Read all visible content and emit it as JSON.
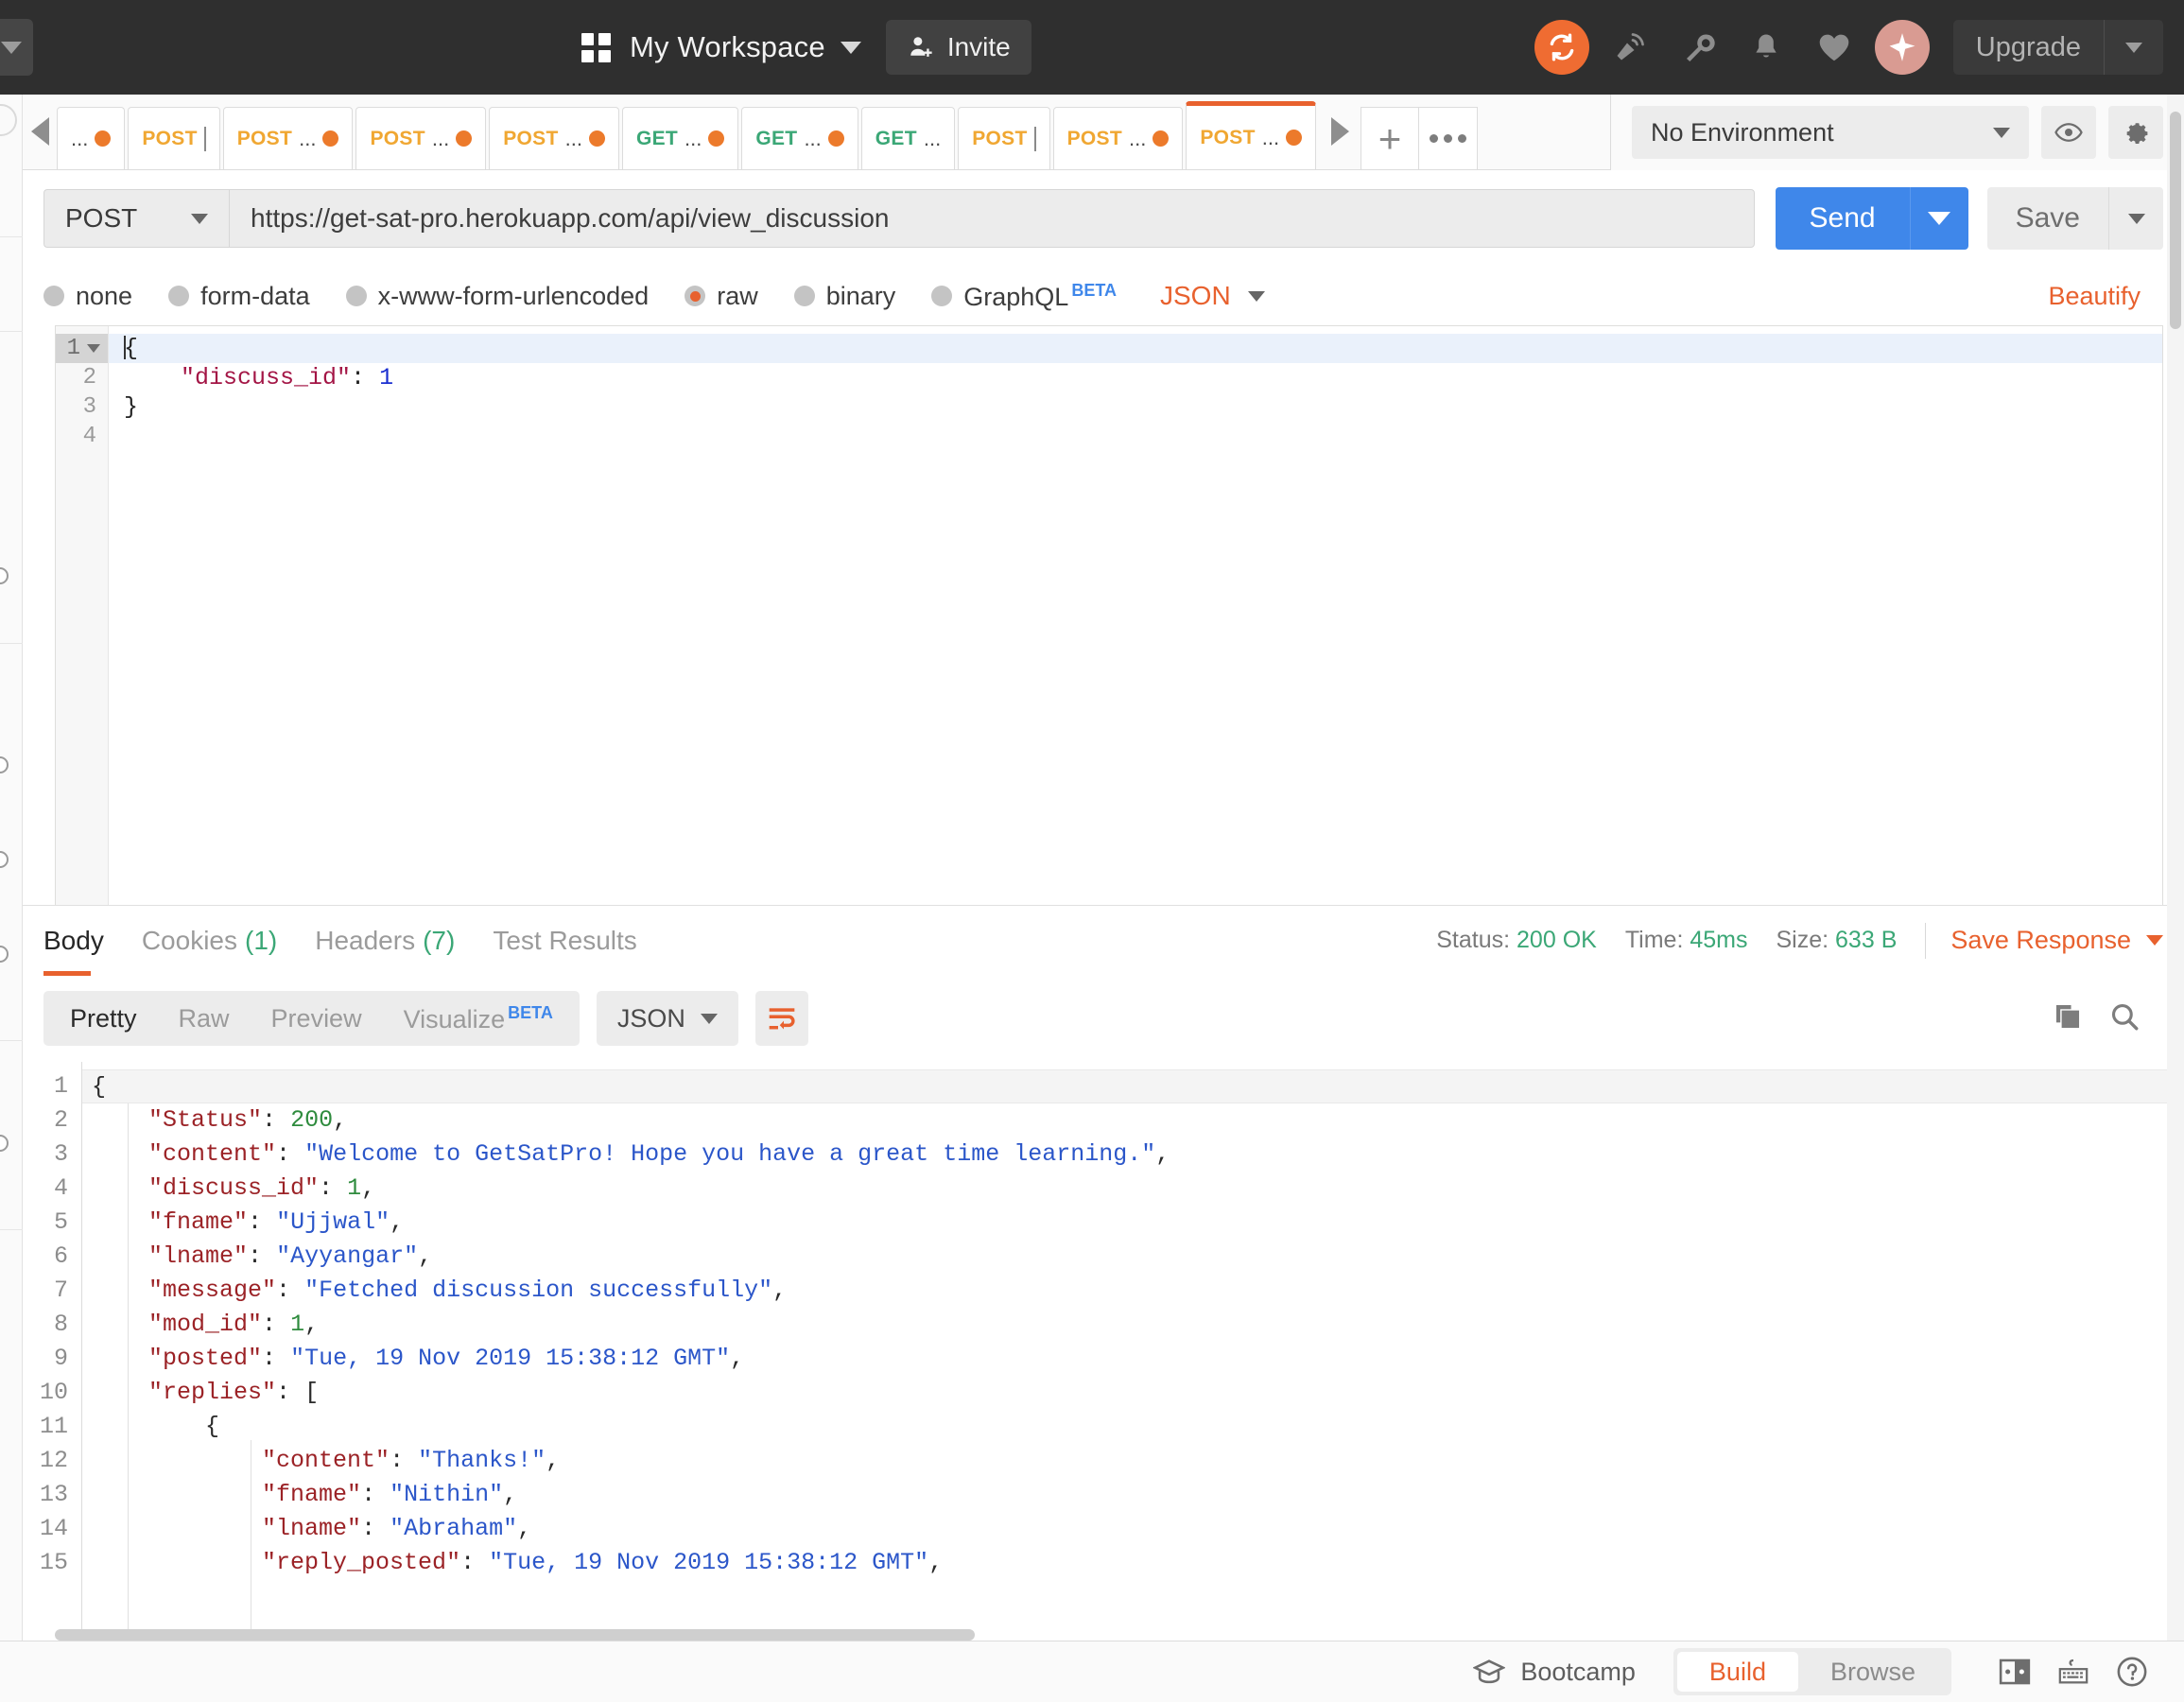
{
  "topbar": {
    "workspace_name": "My Workspace",
    "invite_label": "Invite",
    "upgrade_label": "Upgrade",
    "icons": [
      "sync-icon",
      "satellite-icon",
      "wrench-icon",
      "bell-icon",
      "heart-icon",
      "sparkle-icon"
    ]
  },
  "tabs": {
    "items": [
      {
        "method": "",
        "title": "...",
        "dirty": true,
        "active": false
      },
      {
        "method": "POST",
        "title": "",
        "dirty": false,
        "active": false,
        "cursor": true
      },
      {
        "method": "POST",
        "title": "...",
        "dirty": true,
        "active": false
      },
      {
        "method": "POST",
        "title": "...",
        "dirty": true,
        "active": false
      },
      {
        "method": "POST",
        "title": "...",
        "dirty": true,
        "active": false
      },
      {
        "method": "GET",
        "title": "...",
        "dirty": true,
        "active": false
      },
      {
        "method": "GET",
        "title": "...",
        "dirty": true,
        "active": false
      },
      {
        "method": "GET",
        "title": "...",
        "dirty": false,
        "active": false
      },
      {
        "method": "POST",
        "title": "",
        "dirty": false,
        "active": false,
        "cursor": true
      },
      {
        "method": "POST",
        "title": "...",
        "dirty": true,
        "active": false
      },
      {
        "method": "POST",
        "title": "...",
        "dirty": true,
        "active": true
      }
    ],
    "new_tab_label": "+",
    "environment": "No Environment"
  },
  "request": {
    "method": "POST",
    "url": "https://get-sat-pro.herokuapp.com/api/view_discussion",
    "send_label": "Send",
    "save_label": "Save",
    "beautify_label": "Beautify",
    "body_format": "JSON",
    "body_types": [
      {
        "label": "none",
        "selected": false
      },
      {
        "label": "form-data",
        "selected": false
      },
      {
        "label": "x-www-form-urlencoded",
        "selected": false
      },
      {
        "label": "raw",
        "selected": true
      },
      {
        "label": "binary",
        "selected": false
      },
      {
        "label": "GraphQL",
        "selected": false,
        "beta": "BETA"
      }
    ],
    "body_lines": [
      {
        "n": "1",
        "current": true,
        "fold": true,
        "html": "<span class=\"caretbar\"></span><span class=\"k-punc\">{</span>"
      },
      {
        "n": "2",
        "current": false,
        "fold": false,
        "html": "    <span class=\"k-key\">\"discuss_id\"</span><span class=\"k-punc\">:</span> <span class=\"k-num\">1</span>"
      },
      {
        "n": "3",
        "current": false,
        "fold": false,
        "html": "<span class=\"k-punc\">}</span>"
      },
      {
        "n": "4",
        "current": false,
        "fold": false,
        "html": ""
      }
    ]
  },
  "response": {
    "tabs": [
      {
        "label": "Body",
        "count": "",
        "active": true
      },
      {
        "label": "Cookies",
        "count": "(1)",
        "active": false
      },
      {
        "label": "Headers",
        "count": "(7)",
        "active": false
      },
      {
        "label": "Test Results",
        "count": "",
        "active": false
      }
    ],
    "status_label": "Status:",
    "status_value": "200 OK",
    "time_label": "Time:",
    "time_value": "45ms",
    "size_label": "Size:",
    "size_value": "633 B",
    "save_response_label": "Save Response",
    "view_modes": [
      {
        "label": "Pretty",
        "active": true
      },
      {
        "label": "Raw",
        "active": false
      },
      {
        "label": "Preview",
        "active": false
      },
      {
        "label": "Visualize",
        "active": false,
        "beta": "BETA"
      }
    ],
    "format": "JSON",
    "body_lines": [
      {
        "n": "1",
        "html": "<span class=\"j-punc\">{</span>"
      },
      {
        "n": "2",
        "html": "    <span class=\"j-key\">\"Status\"</span><span class=\"j-punc\">:</span> <span class=\"j-num\">200</span><span class=\"j-punc\">,</span>"
      },
      {
        "n": "3",
        "html": "    <span class=\"j-key\">\"content\"</span><span class=\"j-punc\">:</span> <span class=\"j-str\">\"Welcome to GetSatPro! Hope you have a great time learning.\"</span><span class=\"j-punc\">,</span>"
      },
      {
        "n": "4",
        "html": "    <span class=\"j-key\">\"discuss_id\"</span><span class=\"j-punc\">:</span> <span class=\"j-num\">1</span><span class=\"j-punc\">,</span>"
      },
      {
        "n": "5",
        "html": "    <span class=\"j-key\">\"fname\"</span><span class=\"j-punc\">:</span> <span class=\"j-str\">\"Ujjwal\"</span><span class=\"j-punc\">,</span>"
      },
      {
        "n": "6",
        "html": "    <span class=\"j-key\">\"lname\"</span><span class=\"j-punc\">:</span> <span class=\"j-str\">\"Ayyangar\"</span><span class=\"j-punc\">,</span>"
      },
      {
        "n": "7",
        "html": "    <span class=\"j-key\">\"message\"</span><span class=\"j-punc\">:</span> <span class=\"j-str\">\"Fetched discussion successfully\"</span><span class=\"j-punc\">,</span>"
      },
      {
        "n": "8",
        "html": "    <span class=\"j-key\">\"mod_id\"</span><span class=\"j-punc\">:</span> <span class=\"j-num\">1</span><span class=\"j-punc\">,</span>"
      },
      {
        "n": "9",
        "html": "    <span class=\"j-key\">\"posted\"</span><span class=\"j-punc\">:</span> <span class=\"j-str\">\"Tue, 19 Nov 2019 15:38:12 GMT\"</span><span class=\"j-punc\">,</span>"
      },
      {
        "n": "10",
        "html": "    <span class=\"j-key\">\"replies\"</span><span class=\"j-punc\">:</span> <span class=\"j-punc\">[</span>"
      },
      {
        "n": "11",
        "html": "        <span class=\"j-punc\">{</span>"
      },
      {
        "n": "12",
        "html": "            <span class=\"j-key\">\"content\"</span><span class=\"j-punc\">:</span> <span class=\"j-str\">\"Thanks!\"</span><span class=\"j-punc\">,</span>"
      },
      {
        "n": "13",
        "html": "            <span class=\"j-key\">\"fname\"</span><span class=\"j-punc\">:</span> <span class=\"j-str\">\"Nithin\"</span><span class=\"j-punc\">,</span>"
      },
      {
        "n": "14",
        "html": "            <span class=\"j-key\">\"lname\"</span><span class=\"j-punc\">:</span> <span class=\"j-str\">\"Abraham\"</span><span class=\"j-punc\">,</span>"
      },
      {
        "n": "15",
        "html": "            <span class=\"j-key\">\"reply_posted\"</span><span class=\"j-punc\">:</span> <span class=\"j-str\">\"Tue, 19 Nov 2019 15:38:12 GMT\"</span><span class=\"j-punc\">,</span>"
      }
    ]
  },
  "bottombar": {
    "bootcamp_label": "Bootcamp",
    "build_label": "Build",
    "browse_label": "Browse"
  },
  "colors": {
    "accent": "#e8612e",
    "send_blue": "#3f87ea",
    "success_green": "#3ba776",
    "post_orange": "#f0a732",
    "get_green": "#3ba776",
    "topbar_bg": "#2f2f2f"
  }
}
